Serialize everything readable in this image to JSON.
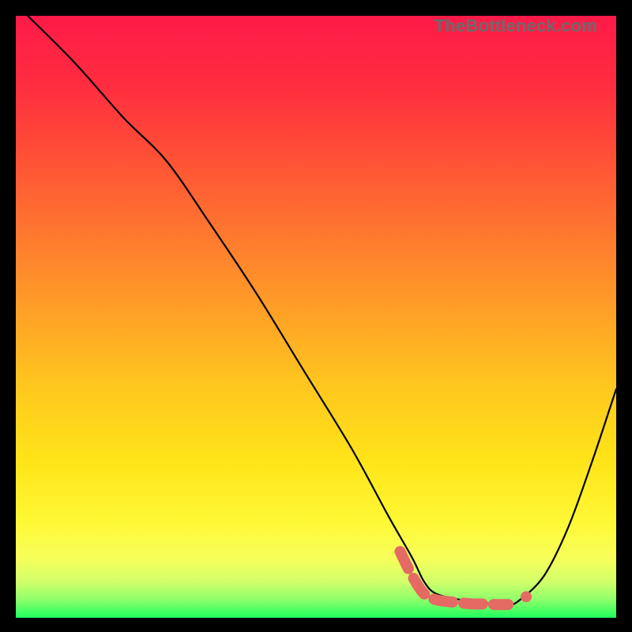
{
  "watermark": "TheBottleneck.com",
  "chart_data": {
    "type": "line",
    "title": "",
    "xlabel": "",
    "ylabel": "",
    "xlim": [
      0,
      100
    ],
    "ylim": [
      0,
      100
    ],
    "grid": false,
    "legend": false,
    "series": [
      {
        "name": "bottleneck-curve",
        "style": "solid",
        "color": "#000000",
        "x": [
          2,
          10,
          18,
          25,
          32,
          40,
          48,
          56,
          62,
          66,
          68,
          70,
          74,
          78,
          80,
          82,
          84,
          88,
          92,
          96,
          100
        ],
        "y": [
          100,
          92,
          83,
          76,
          66,
          54,
          41,
          28,
          17,
          10,
          6,
          4,
          3,
          2.5,
          2,
          2,
          3,
          7,
          15,
          26,
          38
        ]
      },
      {
        "name": "highlight-dashed",
        "style": "dashed",
        "color": "#e46a63",
        "x": [
          64,
          66,
          68,
          70,
          72,
          74,
          76,
          78,
          80,
          82
        ],
        "y": [
          11,
          7,
          4,
          3,
          2.7,
          2.5,
          2.3,
          2.3,
          2.2,
          2.2
        ]
      },
      {
        "name": "highlight-dot",
        "style": "dot",
        "color": "#e46a63",
        "x": [
          85
        ],
        "y": [
          3.5
        ]
      }
    ],
    "gradient_stops": [
      {
        "offset": 0.0,
        "color": "#ff1a48"
      },
      {
        "offset": 0.12,
        "color": "#ff2e3f"
      },
      {
        "offset": 0.25,
        "color": "#ff5535"
      },
      {
        "offset": 0.38,
        "color": "#ff7d2e"
      },
      {
        "offset": 0.5,
        "color": "#ffa326"
      },
      {
        "offset": 0.62,
        "color": "#ffc81e"
      },
      {
        "offset": 0.74,
        "color": "#ffe418"
      },
      {
        "offset": 0.84,
        "color": "#fff835"
      },
      {
        "offset": 0.9,
        "color": "#f7ff5a"
      },
      {
        "offset": 0.94,
        "color": "#d2ff6a"
      },
      {
        "offset": 0.97,
        "color": "#8dff6a"
      },
      {
        "offset": 1.0,
        "color": "#1eff5e"
      }
    ]
  }
}
